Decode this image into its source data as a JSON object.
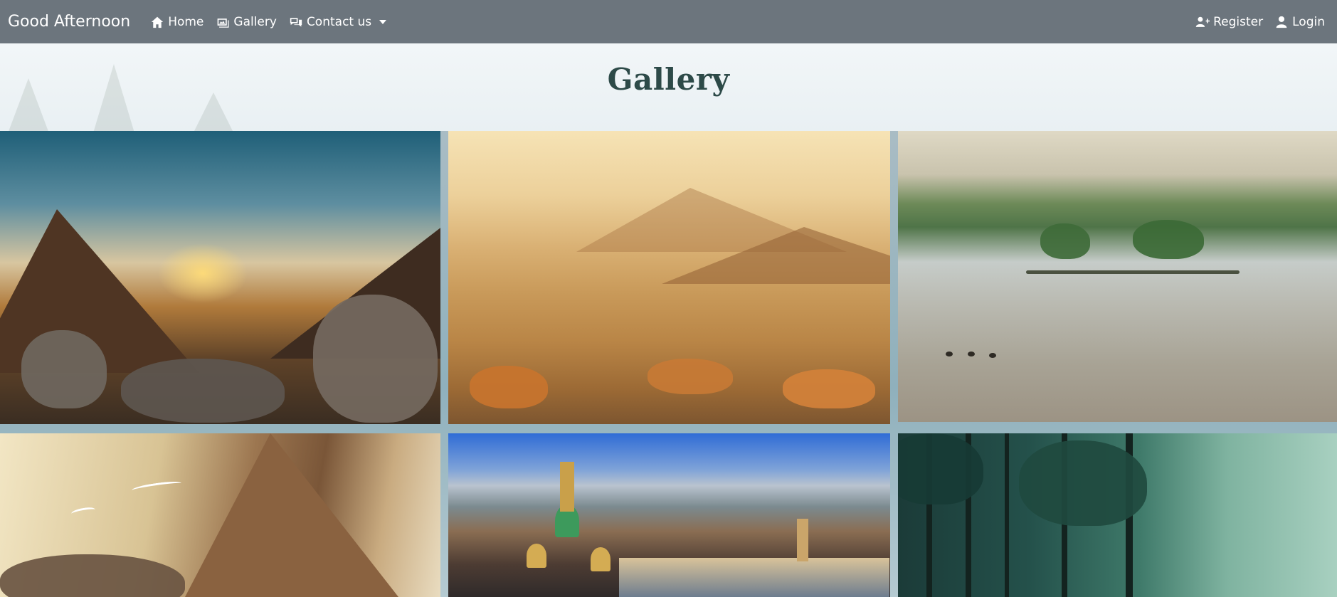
{
  "navbar": {
    "brand": "Good Afternoon",
    "links": [
      {
        "label": "Home",
        "icon": "home-icon"
      },
      {
        "label": "Gallery",
        "icon": "images-icon"
      },
      {
        "label": "Contact us",
        "icon": "comments-icon",
        "dropdown": true
      }
    ],
    "right_links": [
      {
        "label": "Register",
        "icon": "user-plus-icon"
      },
      {
        "label": "Login",
        "icon": "user-icon"
      }
    ],
    "background_color": "#6c757d"
  },
  "header": {
    "title": "Gallery",
    "title_color": "#2d4a48"
  },
  "gallery": {
    "images": [
      {
        "name": "sunset-mountain-valley-rocks"
      },
      {
        "name": "misty-golden-hills-autumn-trees"
      },
      {
        "name": "foggy-lake-island-ducks"
      },
      {
        "name": "cliffs-with-flying-swans"
      },
      {
        "name": "city-cathedral-river-dusk"
      },
      {
        "name": "sunlit-forest-trees"
      }
    ]
  }
}
